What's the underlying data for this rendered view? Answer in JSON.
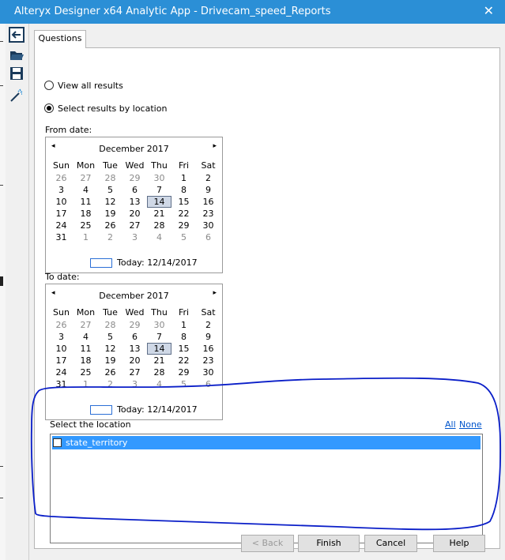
{
  "window": {
    "title": "Alteryx Designer x64 Analytic App - Drivecam_speed_Reports",
    "close_glyph": "✕"
  },
  "toolbar": {
    "icons": [
      "exit-icon",
      "open-folder-icon",
      "save-icon",
      "magic-wand-icon"
    ]
  },
  "tabs": [
    {
      "label": "Questions"
    }
  ],
  "options": {
    "view_all": "View all results",
    "by_location": "Select results by location",
    "selected": "by_location"
  },
  "from_date": {
    "label": "From date:",
    "month": "December 2017",
    "prev": "◂",
    "next": "▸",
    "dow": [
      "Sun",
      "Mon",
      "Tue",
      "Wed",
      "Thu",
      "Fri",
      "Sat"
    ],
    "days": [
      "26",
      "27",
      "28",
      "29",
      "30",
      "1",
      "2",
      "3",
      "4",
      "5",
      "6",
      "7",
      "8",
      "9",
      "10",
      "11",
      "12",
      "13",
      "14",
      "15",
      "16",
      "17",
      "18",
      "19",
      "20",
      "21",
      "22",
      "23",
      "24",
      "25",
      "26",
      "27",
      "28",
      "29",
      "30",
      "31",
      "1",
      "2",
      "3",
      "4",
      "5",
      "6"
    ],
    "selected": "14",
    "today": "Today: 12/14/2017"
  },
  "to_date": {
    "label": "To date:",
    "month": "December 2017",
    "prev": "◂",
    "next": "▸",
    "dow": [
      "Sun",
      "Mon",
      "Tue",
      "Wed",
      "Thu",
      "Fri",
      "Sat"
    ],
    "days": [
      "26",
      "27",
      "28",
      "29",
      "30",
      "1",
      "2",
      "3",
      "4",
      "5",
      "6",
      "7",
      "8",
      "9",
      "10",
      "11",
      "12",
      "13",
      "14",
      "15",
      "16",
      "17",
      "18",
      "19",
      "20",
      "21",
      "22",
      "23",
      "24",
      "25",
      "26",
      "27",
      "28",
      "29",
      "30",
      "31",
      "1",
      "2",
      "3",
      "4",
      "5",
      "6"
    ],
    "selected": "14",
    "today": "Today: 12/14/2017"
  },
  "location": {
    "label": "Select the location",
    "all_link": "All",
    "none_link": "None",
    "items": [
      {
        "label": "state_territory",
        "checked": false
      }
    ]
  },
  "buttons": {
    "back": "< Back",
    "finish": "Finish",
    "cancel": "Cancel",
    "help": "Help"
  },
  "colors": {
    "titlebar": "#2b8fd6",
    "selection": "#3399ff",
    "annotation": "#0a1ec8"
  }
}
